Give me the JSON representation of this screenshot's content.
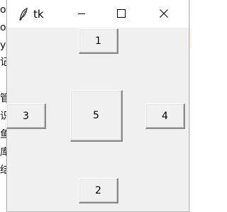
{
  "background_app": {
    "fragments": [
      "od",
      "o",
      "y",
      "记",
      "管",
      "识",
      "鱼",
      "库",
      "结"
    ]
  },
  "window": {
    "title": "tk",
    "icon": "feather-icon",
    "controls": {
      "minimize_icon": "minimize-icon",
      "maximize_icon": "maximize-icon",
      "close_icon": "close-icon"
    }
  },
  "buttons": {
    "top": "1",
    "bottom": "2",
    "left": "3",
    "right": "4",
    "center": "5"
  }
}
